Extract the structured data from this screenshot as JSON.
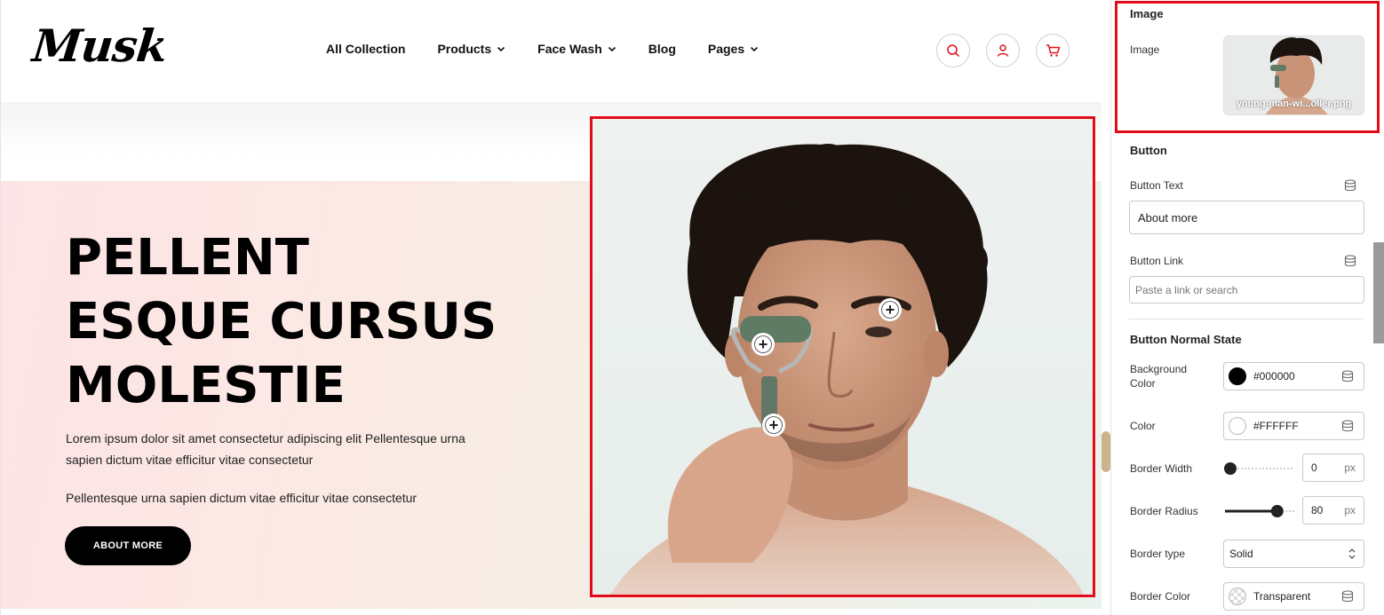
{
  "site": {
    "logo": "Musk",
    "nav": [
      {
        "label": "All Collection",
        "has_dropdown": false
      },
      {
        "label": "Products",
        "has_dropdown": true
      },
      {
        "label": "Face Wash",
        "has_dropdown": true
      },
      {
        "label": "Blog",
        "has_dropdown": false
      },
      {
        "label": "Pages",
        "has_dropdown": true
      }
    ],
    "icons": [
      "search-icon",
      "user-icon",
      "cart-icon"
    ],
    "accent_color": "#e30b17"
  },
  "hero": {
    "title_lines": [
      "PELLENT",
      "ESQUE CURSUS",
      "MOLESTIE"
    ],
    "paragraph1": "Lorem ipsum dolor sit amet consectetur adipiscing elit Pellentesque urna sapien dictum vitae efficitur vitae consectetur",
    "paragraph2": "Pellentesque urna sapien dictum vitae efficitur vitae consectetur",
    "button_label": "ABOUT MORE",
    "hotspot_symbol": "+"
  },
  "panel": {
    "image_section": {
      "title": "Image",
      "label": "Image",
      "file_name": "young-man-wi...oller.png"
    },
    "button_section": {
      "title": "Button",
      "text_label": "Button Text",
      "text_value": "About more",
      "link_label": "Button Link",
      "link_placeholder": "Paste a link or search"
    },
    "normal_state": {
      "title": "Button Normal State",
      "bg_label": "Background Color",
      "bg_value": "#000000",
      "color_label": "Color",
      "color_value": "#FFFFFF",
      "border_width_label": "Border Width",
      "border_width_value": "0",
      "border_width_fraction": 0.0,
      "border_radius_label": "Border Radius",
      "border_radius_value": "80",
      "border_radius_fraction": 0.8,
      "unit": "px",
      "border_type_label": "Border type",
      "border_type_value": "Solid",
      "border_color_label": "Border Color",
      "border_color_value": "Transparent"
    }
  }
}
